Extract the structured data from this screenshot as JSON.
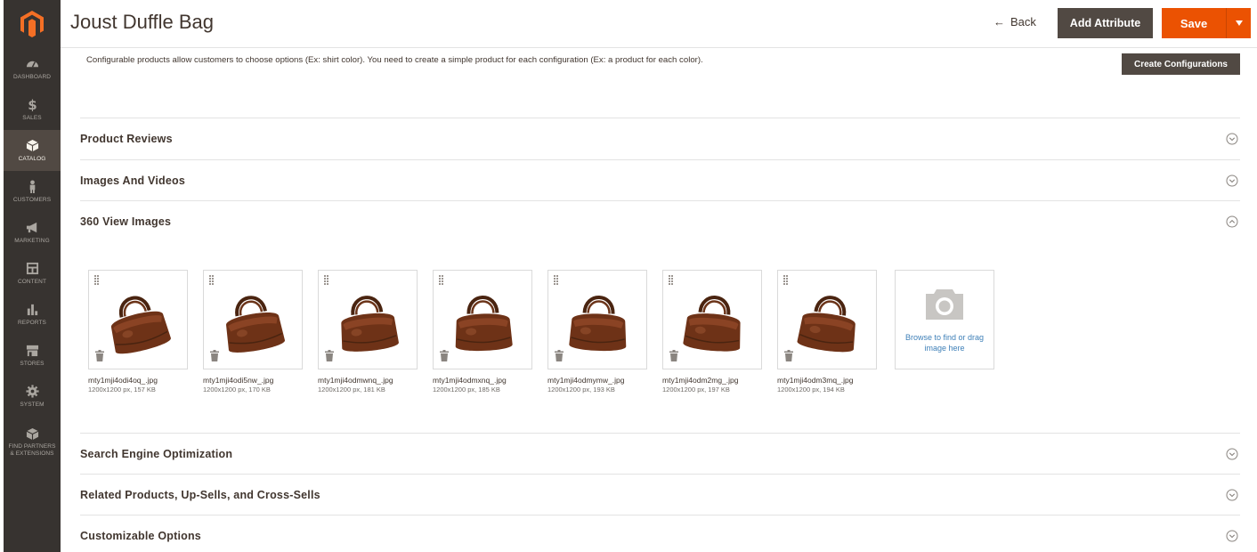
{
  "sidebar": {
    "logo": "magento-logo",
    "items": [
      {
        "label": "DASHBOARD",
        "icon": "speedometer-icon",
        "active": false
      },
      {
        "label": "SALES",
        "icon": "dollar-icon",
        "active": false
      },
      {
        "label": "CATALOG",
        "icon": "cube-icon",
        "active": true
      },
      {
        "label": "CUSTOMERS",
        "icon": "person-icon",
        "active": false
      },
      {
        "label": "MARKETING",
        "icon": "megaphone-icon",
        "active": false
      },
      {
        "label": "CONTENT",
        "icon": "layout-icon",
        "active": false
      },
      {
        "label": "REPORTS",
        "icon": "bar-chart-icon",
        "active": false
      },
      {
        "label": "STORES",
        "icon": "store-icon",
        "active": false
      },
      {
        "label": "SYSTEM",
        "icon": "gear-icon",
        "active": false
      },
      {
        "label_line1": "FIND PARTNERS",
        "label_line2": "& EXTENSIONS",
        "icon": "box-icon",
        "active": false
      }
    ]
  },
  "header": {
    "title": "Joust Duffle Bag",
    "back_label": "Back",
    "add_attribute_label": "Add Attribute",
    "save_label": "Save"
  },
  "config": {
    "note": "Configurable products allow customers to choose options (Ex: shirt color). You need to create a simple product for each configuration (Ex: a product for each color).",
    "create_label": "Create Configurations"
  },
  "sections": {
    "product_reviews": "Product Reviews",
    "images_videos": "Images And Videos",
    "view_360": "360 View Images",
    "seo": "Search Engine Optimization",
    "related": "Related Products, Up-Sells, and Cross-Sells",
    "custom_options": "Customizable Options"
  },
  "images": [
    {
      "name": "mty1mji4odi4oq_.jpg",
      "meta": "1200x1200 px, 157 KB"
    },
    {
      "name": "mty1mji4odi5nw_.jpg",
      "meta": "1200x1200 px, 170 KB"
    },
    {
      "name": "mty1mji4odmwnq_.jpg",
      "meta": "1200x1200 px, 181 KB"
    },
    {
      "name": "mty1mji4odmxnq_.jpg",
      "meta": "1200x1200 px, 185 KB"
    },
    {
      "name": "mty1mji4odmymw_.jpg",
      "meta": "1200x1200 px, 193 KB"
    },
    {
      "name": "mty1mji4odm2mg_.jpg",
      "meta": "1200x1200 px, 197 KB"
    },
    {
      "name": "mty1mji4odm3mq_.jpg",
      "meta": "1200x1200 px, 194 KB"
    }
  ],
  "upload": {
    "text": "Browse to find or drag image here"
  },
  "colors": {
    "sidebar_bg": "#373330",
    "active_bg": "#514943",
    "accent": "#eb5202",
    "link": "#3f80b8"
  }
}
